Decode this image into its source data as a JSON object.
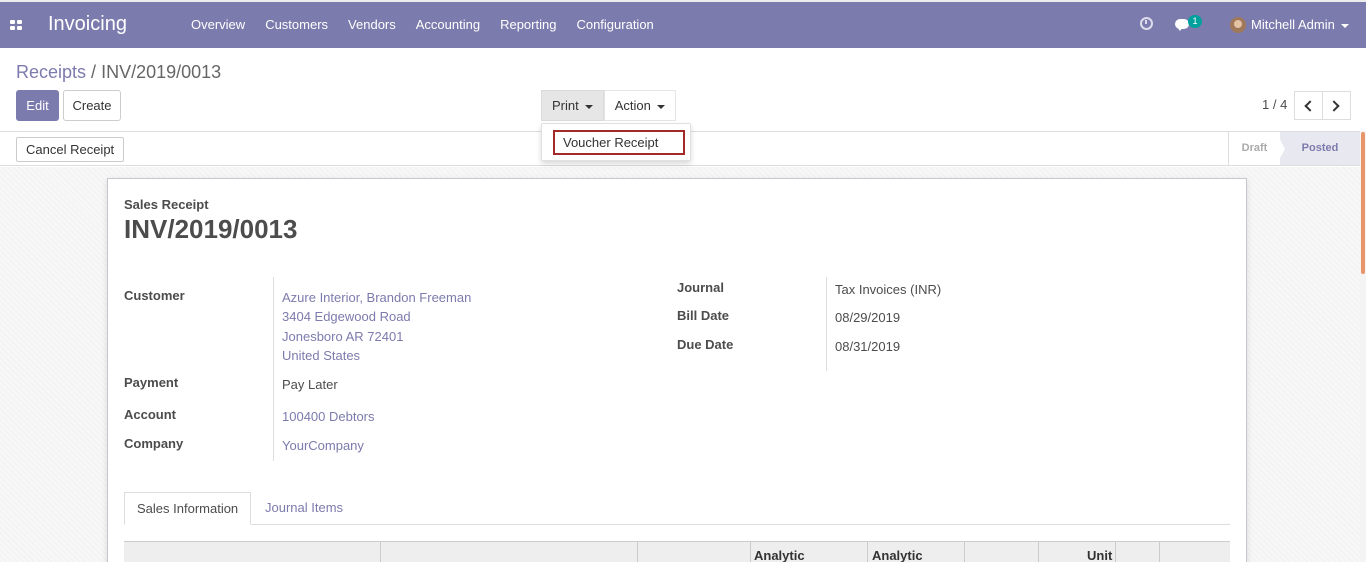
{
  "app": {
    "title": "Invoicing"
  },
  "menu": [
    "Overview",
    "Customers",
    "Vendors",
    "Accounting",
    "Reporting",
    "Configuration"
  ],
  "systray": {
    "message_count": "1",
    "user": "Mitchell Admin"
  },
  "breadcrumb": {
    "parent": "Receipts",
    "separator": "/",
    "current": "INV/2019/0013"
  },
  "buttons": {
    "edit": "Edit",
    "create": "Create",
    "print": "Print",
    "action": "Action",
    "cancel_receipt": "Cancel Receipt"
  },
  "print_menu": {
    "items": [
      "Voucher Receipt"
    ]
  },
  "pager": {
    "value": "1 / 4"
  },
  "statusbar": {
    "stages": [
      "Draft",
      "Posted"
    ],
    "current": "Posted"
  },
  "document": {
    "type": "Sales Receipt",
    "name": "INV/2019/0013",
    "left_fields": {
      "customer_label": "Customer",
      "customer_lines": [
        "Azure Interior, Brandon Freeman",
        "3404 Edgewood Road",
        "Jonesboro AR 72401",
        "United States"
      ],
      "payment_label": "Payment",
      "payment_value": "Pay Later",
      "account_label": "Account",
      "account_value": "100400 Debtors",
      "company_label": "Company",
      "company_value": "YourCompany"
    },
    "right_fields": {
      "journal_label": "Journal",
      "journal_value": "Tax Invoices (INR)",
      "bill_date_label": "Bill Date",
      "bill_date_value": "08/29/2019",
      "due_date_label": "Due Date",
      "due_date_value": "08/31/2019"
    },
    "tabs": [
      "Sales Information",
      "Journal Items"
    ],
    "table_headers": [
      "",
      "",
      "Analytic",
      "Analytic",
      "",
      "Unit"
    ]
  },
  "colors": {
    "brand": "#7c7bad",
    "highlight": "#a42a2a",
    "badge": "#00a09d"
  }
}
